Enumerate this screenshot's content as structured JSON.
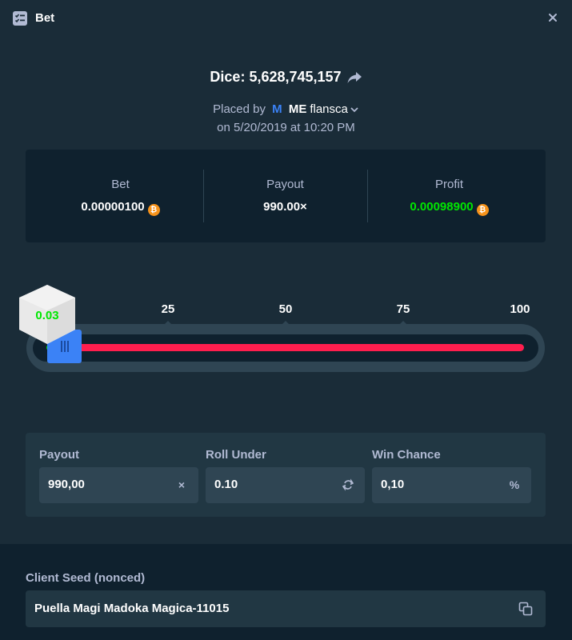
{
  "header": {
    "title": "Bet"
  },
  "game": {
    "title": "Dice: 5,628,745,157"
  },
  "placed": {
    "prefix": "Placed by",
    "badge": "M",
    "rank": "ME",
    "username": "flansca",
    "datetime": "on 5/20/2019 at 10:20 PM"
  },
  "stats": {
    "bet": {
      "label": "Bet",
      "value": "0.00000100"
    },
    "payout": {
      "label": "Payout",
      "value": "990.00×"
    },
    "profit": {
      "label": "Profit",
      "value": "0.00098900"
    },
    "currency_symbol": "₿"
  },
  "slider": {
    "ticks": [
      "25",
      "50",
      "75",
      "100"
    ],
    "result": "0.03",
    "roll_under_value": 0.1,
    "max": 100
  },
  "params": {
    "payout": {
      "label": "Payout",
      "value": "990,00",
      "suffix": "×"
    },
    "roll_under": {
      "label": "Roll Under",
      "value": "0.10"
    },
    "win_chance": {
      "label": "Win Chance",
      "value": "0,10",
      "suffix": "%"
    }
  },
  "seed": {
    "label": "Client Seed (nonced)",
    "value": "Puella Magi Madoka Magica-11015"
  },
  "colors": {
    "background": "#1a2c38",
    "panel": "#0f212e",
    "input": "#2f4553",
    "win": "#00e701",
    "lose": "#ff1e4e",
    "accent": "#3b82f6",
    "btc": "#f7931a"
  }
}
